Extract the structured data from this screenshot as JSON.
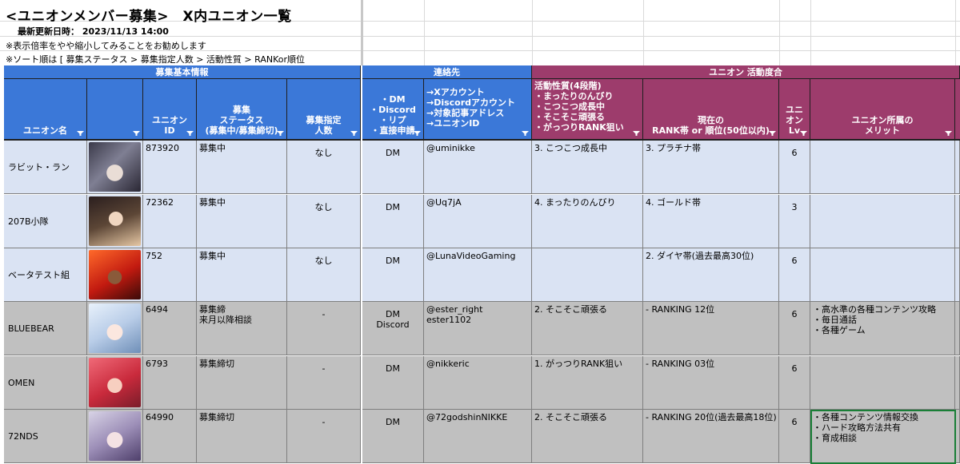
{
  "sheet": {
    "title": "<ユニオンメンバー募集>　X内ユニオン一覧",
    "updated": "最新更新日時：  2023/11/13 14:00",
    "note1": "※表示倍率をやや縮小してみることをお勧めします",
    "note2": "※ソート順は [ 募集ステータス > 募集指定人数 > 活動性質 > RANKor順位"
  },
  "bands": {
    "basic": "募集基本情報",
    "contact": "連絡先",
    "activity": "ユニオン 活動度合"
  },
  "headers": {
    "name": "ユニオン名",
    "image": "",
    "union_id": "ユニオン\nID",
    "status": "募集\nステータス\n(募集中/募集締切)",
    "count": "募集指定\n人数",
    "method": "・DM\n・Discord\n・リプ\n・直接申請",
    "account": "→Xアカウント\n→Discordアカウント\n→対象記事アドレス\n→ユニオンID",
    "activity": "活動性質(4段階)\n・まったりのんびり\n・こつこつ成長中\n・そこそこ頑張る\n・がっつりRANK狙い",
    "rank": "現在の\nRANK帯 or 順位(50位以内)",
    "lv": "ユニ\nオン\nLv",
    "merit": "ユニオン所属の\nメリット"
  },
  "colors": {
    "blue_header": "#3b78d8",
    "magenta_header": "#9d3c6c",
    "row_light": "#dae3f3",
    "row_gray": "#c0c0c0"
  },
  "rows": [
    {
      "name": "ラビット・ラン",
      "id": "873920",
      "status": "募集中",
      "count": "なし",
      "method": "DM",
      "account": "@uminikke",
      "activity": "3.  こつこつ成長中",
      "rank": "3.  プラチナ帯",
      "lv": "6",
      "merit": "",
      "avatar": "dark-hair-headphones"
    },
    {
      "name": "207B小隊",
      "id": "72362",
      "status": "募集中",
      "count": "なし",
      "method": "DM",
      "account": "@Uq7jA",
      "activity": "4.  まったりのんびり",
      "rank": "4.  ゴールド帯",
      "lv": "3",
      "merit": "",
      "avatar": "dark-hair-girl"
    },
    {
      "name": "ベータテスト組",
      "id": "752",
      "status": "募集中",
      "count": "なし",
      "method": "DM",
      "account": "@LunaVideoGaming",
      "activity": "",
      "rank": "2.  ダイヤ帯(過去最高30位)",
      "lv": "6",
      "merit": "",
      "avatar": "red-hair-girl"
    },
    {
      "name": "BLUEBEAR",
      "id": "6494",
      "status": "募集締\n来月以降相談",
      "count": "-",
      "method": "DM\nDiscord",
      "account": "@ester_right\nester1102",
      "activity": "2.  そこそこ頑張る",
      "rank": "- RANKING 12位",
      "lv": "6",
      "merit": "・高水準の各種コンテンツ攻略\n・毎日通話\n・各種ゲーム",
      "avatar": "white-hair-girl"
    },
    {
      "name": "OMEN",
      "id": "6793",
      "status": "募集締切",
      "count": "-",
      "method": "DM",
      "account": "@nikkeric",
      "activity": "1.  がっつりRANK狙い",
      "rank": "- RANKING 03位",
      "lv": "6",
      "merit": "",
      "avatar": "pink-hair-girl"
    },
    {
      "name": "72NDS",
      "id": "64990",
      "status": "募集締切",
      "count": "-",
      "method": "DM",
      "account": "@72godshinNIKKE",
      "activity": "2.  そこそこ頑張る",
      "rank": "- RANKING 20位(過去最高18位)",
      "lv": "6",
      "merit": "・各種コンテンツ情報交換\n・ハード攻略方法共有\n・育成相談",
      "avatar": "silver-hair-girl"
    }
  ]
}
